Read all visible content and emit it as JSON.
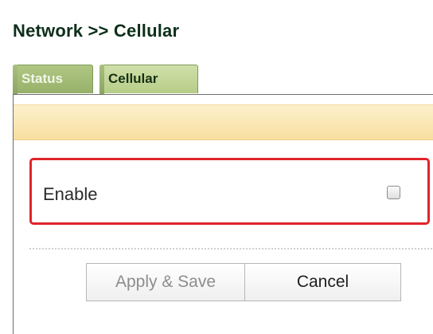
{
  "breadcrumb": {
    "title": "Network >> Cellular"
  },
  "tabs": [
    {
      "label": "Status",
      "active": false
    },
    {
      "label": "Cellular",
      "active": true
    }
  ],
  "form": {
    "enable": {
      "label": "Enable",
      "checked": false
    }
  },
  "buttons": {
    "apply_label": "Apply & Save",
    "apply_enabled": false,
    "cancel_label": "Cancel"
  },
  "colors": {
    "tab_accent": "#97b06a",
    "banner": "#f7dfa0",
    "highlight": "#e0242b",
    "title": "#0d2f1a"
  }
}
